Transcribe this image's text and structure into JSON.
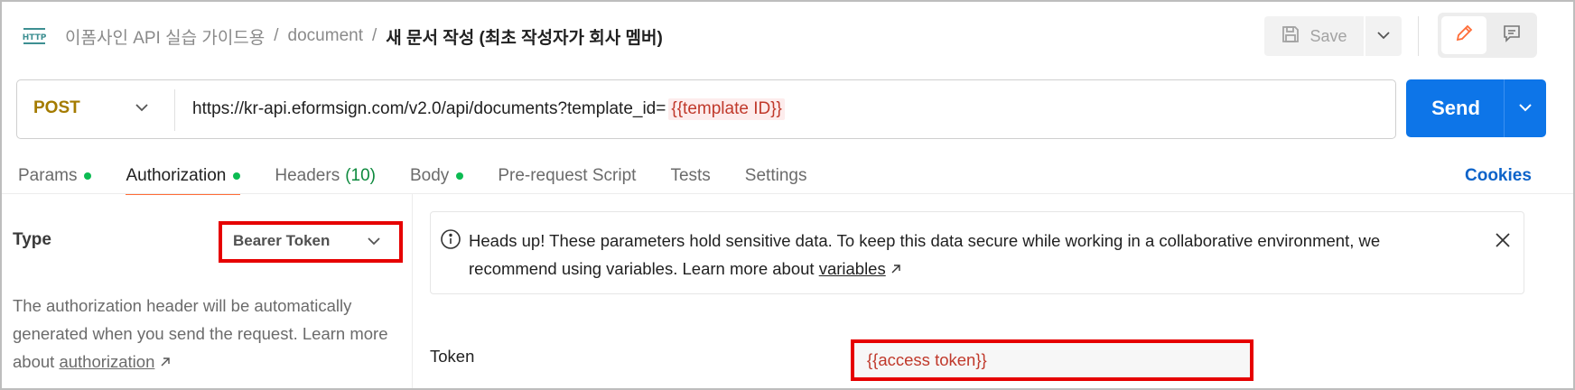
{
  "header": {
    "icon": "http-icon",
    "breadcrumb": [
      "이폼사인 API 실습 가이드용",
      "document"
    ],
    "separator": "/",
    "current": "새 문서 작성 (최초 작성자가 회사 멤버)",
    "save_label": "Save"
  },
  "request": {
    "method": "POST",
    "url_prefix": "https://kr-api.eformsign.com/v2.0/api/documents?template_id=",
    "url_variable": "{{template ID}}",
    "send_label": "Send"
  },
  "tabs": [
    {
      "label": "Params",
      "dot": true
    },
    {
      "label": "Authorization",
      "dot": true,
      "active": true
    },
    {
      "label": "Headers",
      "count": "(10)"
    },
    {
      "label": "Body",
      "dot": true
    },
    {
      "label": "Pre-request Script"
    },
    {
      "label": "Tests"
    },
    {
      "label": "Settings"
    }
  ],
  "cookies_label": "Cookies",
  "auth": {
    "type_label": "Type",
    "type_value": "Bearer Token",
    "description_prefix": "The authorization header will be automatically generated when you send the request. Learn more about",
    "description_link": "authorization",
    "notice_text": "Heads up! These parameters hold sensitive data. To keep this data secure while working in a collaborative environment, we recommend using variables. Learn more about",
    "notice_link": "variables",
    "token_label": "Token",
    "token_value": "{{access token}}"
  },
  "colors": {
    "accent_orange": "#ff6c37",
    "send_blue": "#0d75e8",
    "highlight_red": "#e60000",
    "status_green": "#0cbb52",
    "method_post": "#a47b00"
  }
}
